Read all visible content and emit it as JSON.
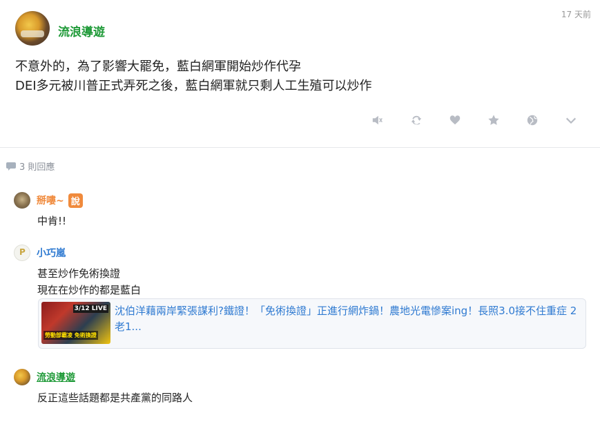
{
  "post": {
    "author": "流浪導遊",
    "time": "17 天前",
    "body": "不意外的，為了影響大罷免，藍白網軍開始炒作代孕\nDEI多元被川普正式弄死之後，藍白網軍就只剩人工生殖可以炒作",
    "actions": [
      "speaker-icon",
      "refresh-icon",
      "heart-icon",
      "star-icon",
      "globe-icon",
      "chevron-down-icon"
    ]
  },
  "replies": {
    "count_label": "3 則回應"
  },
  "comments": [
    {
      "author": "掰嘍~",
      "badge": "說",
      "text": "中肯!!"
    },
    {
      "author": "小巧嵐",
      "text": "甚至炒作免術換證\n現在在炒作的都是藍白"
    },
    {
      "author": "流浪導遊",
      "text": "反正這些話題都是共產黨的同路人"
    }
  ],
  "link_card": {
    "title": "沈伯洋藉兩岸緊張謀利?鐵證！「免術換證」正進行網炸鍋！農地光電慘案ing！長照3.0接不住重症 2老1...",
    "thumb_live": "3/12 LIVE",
    "thumb_caption": "勞動部霸凌 免術換證"
  },
  "colors": {
    "author_green": "#1f9a38",
    "commenter_orange": "#f08a3c",
    "commenter_blue": "#2f7ad1",
    "icon_gray": "#b8bcc4"
  }
}
